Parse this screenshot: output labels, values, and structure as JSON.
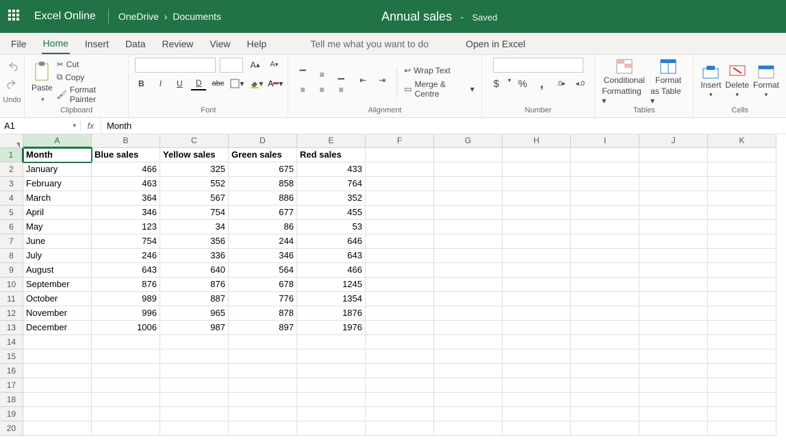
{
  "title": {
    "brand": "Excel Online",
    "crumb1": "OneDrive",
    "crumb2": "Documents",
    "doc": "Annual sales",
    "dash": "-",
    "saved": "Saved"
  },
  "tabs": {
    "file": "File",
    "home": "Home",
    "insert": "Insert",
    "data": "Data",
    "review": "Review",
    "view": "View",
    "help": "Help",
    "tellme": "Tell me what you want to do",
    "open": "Open in Excel"
  },
  "ribbon": {
    "undo": "Undo",
    "paste": "Paste",
    "clipboard": "Clipboard",
    "cut": "Cut",
    "copy": "Copy",
    "fp": "Format Painter",
    "font": "Font",
    "growA": "A▴",
    "shrinkA": "A▾",
    "B": "B",
    "I": "I",
    "U": "U",
    "D": "D",
    "strike": "abc",
    "alignment": "Alignment",
    "wrap": "Wrap Text",
    "merge": "Merge & Centre",
    "number": "Number",
    "dollar": "$",
    "pct": "%",
    "comma": ",",
    "dec1": "←.0",
    "dec2": ".0→",
    "tables": "Tables",
    "condfmt1": "Conditional",
    "condfmt2": "Formatting",
    "astable1": "Format",
    "astable2": "as Table",
    "cells": "Cells",
    "insertc": "Insert",
    "deletec": "Delete",
    "formatc": "Format"
  },
  "fbar": {
    "name": "A1",
    "val": "Month"
  },
  "cols": [
    "A",
    "B",
    "C",
    "D",
    "E",
    "F",
    "G",
    "H",
    "I",
    "J",
    "K"
  ],
  "headers": [
    "Month",
    "Blue sales",
    "Yellow sales",
    "Green sales",
    "Red sales"
  ],
  "data": [
    {
      "m": "January",
      "b": 466,
      "y": 325,
      "g": 675,
      "r": 433
    },
    {
      "m": "February",
      "b": 463,
      "y": 552,
      "g": 858,
      "r": 764
    },
    {
      "m": "March",
      "b": 364,
      "y": 567,
      "g": 886,
      "r": 352
    },
    {
      "m": "April",
      "b": 346,
      "y": 754,
      "g": 677,
      "r": 455
    },
    {
      "m": "May",
      "b": 123,
      "y": 34,
      "g": 86,
      "r": 53
    },
    {
      "m": "June",
      "b": 754,
      "y": 356,
      "g": 244,
      "r": 646
    },
    {
      "m": "July",
      "b": 246,
      "y": 336,
      "g": 346,
      "r": 643
    },
    {
      "m": "August",
      "b": 643,
      "y": 640,
      "g": 564,
      "r": 466
    },
    {
      "m": "September",
      "b": 876,
      "y": 876,
      "g": 678,
      "r": 1245
    },
    {
      "m": "October",
      "b": 989,
      "y": 887,
      "g": 776,
      "r": 1354
    },
    {
      "m": "November",
      "b": 996,
      "y": 965,
      "g": 878,
      "r": 1876
    },
    {
      "m": "December",
      "b": 1006,
      "y": 987,
      "g": 897,
      "r": 1976
    }
  ],
  "emptyrows": 7,
  "chart_data": {
    "type": "table",
    "title": "Annual sales",
    "categories": [
      "January",
      "February",
      "March",
      "April",
      "May",
      "June",
      "July",
      "August",
      "September",
      "October",
      "November",
      "December"
    ],
    "series": [
      {
        "name": "Blue sales",
        "values": [
          466,
          463,
          364,
          346,
          123,
          754,
          246,
          643,
          876,
          989,
          996,
          1006
        ]
      },
      {
        "name": "Yellow sales",
        "values": [
          325,
          552,
          567,
          754,
          34,
          356,
          336,
          640,
          876,
          887,
          965,
          987
        ]
      },
      {
        "name": "Green sales",
        "values": [
          675,
          858,
          886,
          677,
          86,
          244,
          346,
          564,
          678,
          776,
          878,
          897
        ]
      },
      {
        "name": "Red sales",
        "values": [
          433,
          764,
          352,
          455,
          53,
          646,
          643,
          466,
          1245,
          1354,
          1876,
          1976
        ]
      }
    ]
  }
}
